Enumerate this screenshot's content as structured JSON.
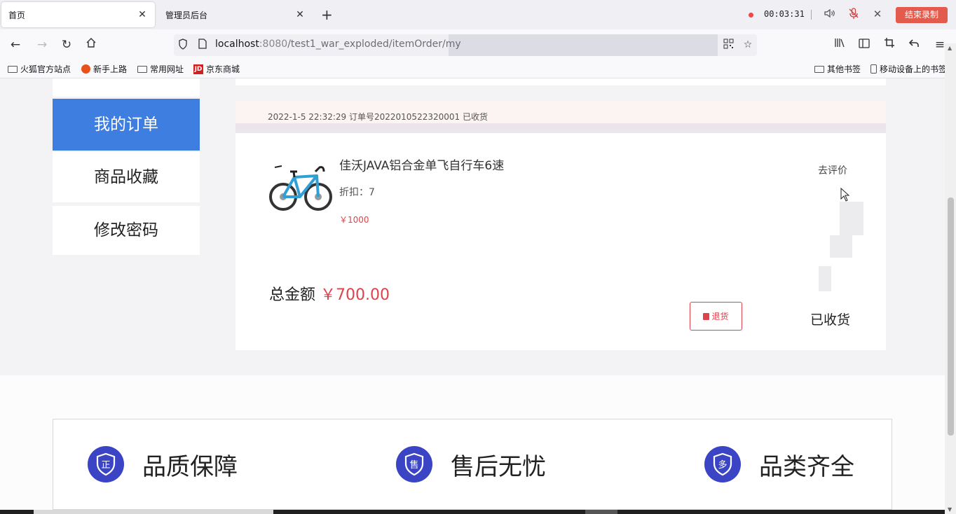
{
  "browser": {
    "tabs": [
      {
        "title": "首页",
        "active": true
      },
      {
        "title": "管理员后台",
        "active": false
      }
    ],
    "new_tab_glyph": "+",
    "close_glyph": "✕",
    "url": {
      "host": "localhost",
      "port": ":8080",
      "path": "/test1_war_exploded/itemOrder/my"
    },
    "bookmarks": [
      "火狐官方站点",
      "新手上路",
      "常用网址",
      "京东商城"
    ],
    "bookmarks_right": [
      "其他书签",
      "移动设备上的书签"
    ]
  },
  "recorder": {
    "time": "00:03:31",
    "stop_label": "结束录制",
    "dot_color": "#e84a4a"
  },
  "sidebar": {
    "items": [
      {
        "label": "我的订单",
        "active": true
      },
      {
        "label": "商品收藏",
        "active": false
      },
      {
        "label": "修改密码",
        "active": false
      }
    ]
  },
  "order": {
    "header": "2022-1-5 22:32:29  订单号202201052232000​1   已收货",
    "item": {
      "name": "佳沃JAVA铝合金单飞自行车6速",
      "discount": "折扣：7",
      "price": "￥1000"
    },
    "review_label": "去评价",
    "total_label": "总金额",
    "total_amount": "￥700.00",
    "refund_label": "退货",
    "status": "已收货"
  },
  "features": [
    {
      "label": "品质保障",
      "icon_char": "正"
    },
    {
      "label": "售后无忧",
      "icon_char": "售"
    },
    {
      "label": "品类齐全",
      "icon_char": "多"
    }
  ],
  "colors": {
    "accent": "#3d7ee0",
    "price": "#e0424b",
    "feature_icon": "#3a44c4"
  }
}
